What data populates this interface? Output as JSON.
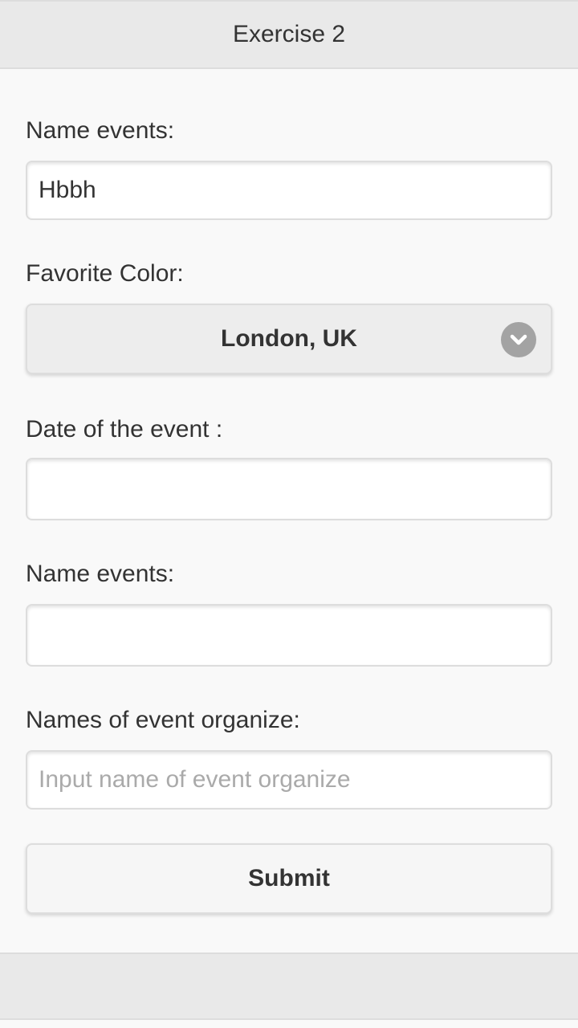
{
  "header": {
    "title": "Exercise 2"
  },
  "form": {
    "name_events_label": "Name events:",
    "name_events_value": "Hbbh",
    "favorite_color_label": "Favorite Color:",
    "favorite_color_selected": "London, UK",
    "date_label": "Date of the event :",
    "date_value": "",
    "name_events_2_label": "Name events:",
    "name_events_2_value": "",
    "organizer_label": "Names of event organize:",
    "organizer_value": "",
    "organizer_placeholder": "Input name of event organize",
    "submit_label": "Submit"
  },
  "icons": {
    "select_arrow": "chevron-down-icon"
  },
  "colors": {
    "header_bg": "#e9e9e9",
    "page_bg": "#f9f9f9",
    "select_arrow_bg": "#a3a3a3"
  }
}
